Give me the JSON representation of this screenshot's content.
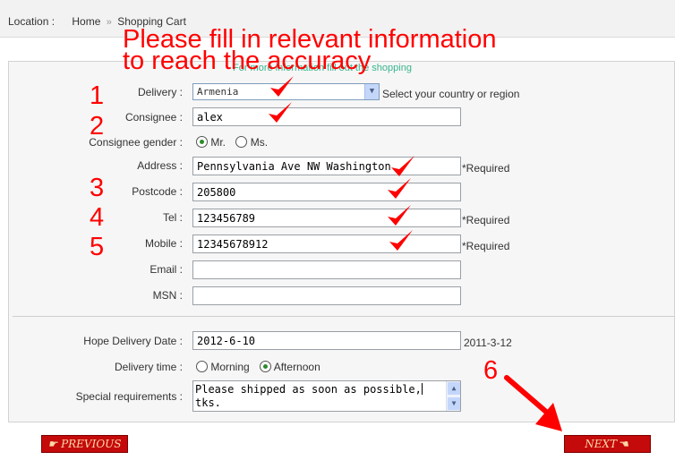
{
  "breadcrumb": {
    "location_label": "Location :",
    "home": "Home",
    "separator": "»",
    "current": "Shopping Cart"
  },
  "annotation": {
    "line1": "Please fill in relevant information",
    "line2": "to reach the accuracy",
    "steps": [
      "1",
      "2",
      "3",
      "4",
      "5",
      "6"
    ],
    "color": "#ff0000"
  },
  "panel": {
    "subtitle": "For more information fill out the shopping"
  },
  "form": {
    "delivery": {
      "label": "Delivery :",
      "value": "Armenia",
      "hint": "Select your country or region"
    },
    "consignee": {
      "label": "Consignee :",
      "value": "alex"
    },
    "gender": {
      "label": "Consignee gender :",
      "options": [
        "Mr.",
        "Ms."
      ],
      "selected": "Mr."
    },
    "address": {
      "label": "Address :",
      "value": "Pennsylvania Ave NW Washington",
      "note": "*Required"
    },
    "postcode": {
      "label": "Postcode :",
      "value": "205800"
    },
    "tel": {
      "label": "Tel :",
      "value": "123456789",
      "note": "*Required"
    },
    "mobile": {
      "label": "Mobile :",
      "value": "12345678912",
      "note": "*Required"
    },
    "email": {
      "label": "Email :",
      "value": ""
    },
    "msn": {
      "label": "MSN :",
      "value": ""
    },
    "hope_date": {
      "label": "Hope Delivery Date :",
      "value": "2012-6-10",
      "hint": "2011-3-12"
    },
    "delivery_time": {
      "label": "Delivery time :",
      "options": [
        "Morning",
        "Afternoon"
      ],
      "selected": "Afternoon"
    },
    "special": {
      "label": "Special requirements :",
      "line1": "Please shipped as soon as possible,",
      "line2": "tks."
    }
  },
  "buttons": {
    "previous": "PREVIOUS",
    "next": "NEXT",
    "color": "#c40a0a"
  },
  "icons": {
    "select_arrow": "chevron-down-icon",
    "scroll_up": "arrow-up-icon",
    "scroll_down": "arrow-down-icon",
    "pointing_hand": "pointing-hand-icon",
    "checkmark": "checkmark-icon",
    "big_arrow": "arrow-down-right-icon"
  }
}
